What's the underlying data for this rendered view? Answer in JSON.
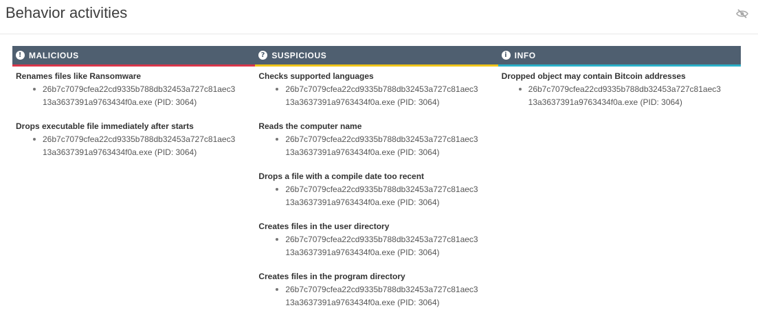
{
  "header": {
    "title": "Behavior activities"
  },
  "sections": {
    "malicious": {
      "label": "MALICIOUS",
      "icon": "exclamation-icon",
      "color": "#d9364a",
      "items": [
        {
          "name": "Renames files like Ransomware",
          "process_line1": "26b7c7079cfea22cd9335b788db32453a727c81aec3",
          "process_line2": "13a3637391a9763434f0a.exe (PID: 3064)"
        },
        {
          "name": "Drops executable file immediately after starts",
          "process_line1": "26b7c7079cfea22cd9335b788db32453a727c81aec3",
          "process_line2": "13a3637391a9763434f0a.exe (PID: 3064)"
        }
      ]
    },
    "suspicious": {
      "label": "SUSPICIOUS",
      "icon": "question-icon",
      "color": "#f0c51a",
      "items": [
        {
          "name": "Checks supported languages",
          "process_line1": "26b7c7079cfea22cd9335b788db32453a727c81aec3",
          "process_line2": "13a3637391a9763434f0a.exe (PID: 3064)"
        },
        {
          "name": "Reads the computer name",
          "process_line1": "26b7c7079cfea22cd9335b788db32453a727c81aec3",
          "process_line2": "13a3637391a9763434f0a.exe (PID: 3064)"
        },
        {
          "name": "Drops a file with a compile date too recent",
          "process_line1": "26b7c7079cfea22cd9335b788db32453a727c81aec3",
          "process_line2": "13a3637391a9763434f0a.exe (PID: 3064)"
        },
        {
          "name": "Creates files in the user directory",
          "process_line1": "26b7c7079cfea22cd9335b788db32453a727c81aec3",
          "process_line2": "13a3637391a9763434f0a.exe (PID: 3064)"
        },
        {
          "name": "Creates files in the program directory",
          "process_line1": "26b7c7079cfea22cd9335b788db32453a727c81aec3",
          "process_line2": "13a3637391a9763434f0a.exe (PID: 3064)"
        }
      ]
    },
    "info": {
      "label": "INFO",
      "icon": "info-icon",
      "color": "#2bb0c8",
      "items": [
        {
          "name": "Dropped object may contain Bitcoin addresses",
          "process_line1": "26b7c7079cfea22cd9335b788db32453a727c81aec3",
          "process_line2": "13a3637391a9763434f0a.exe (PID: 3064)"
        }
      ]
    }
  }
}
